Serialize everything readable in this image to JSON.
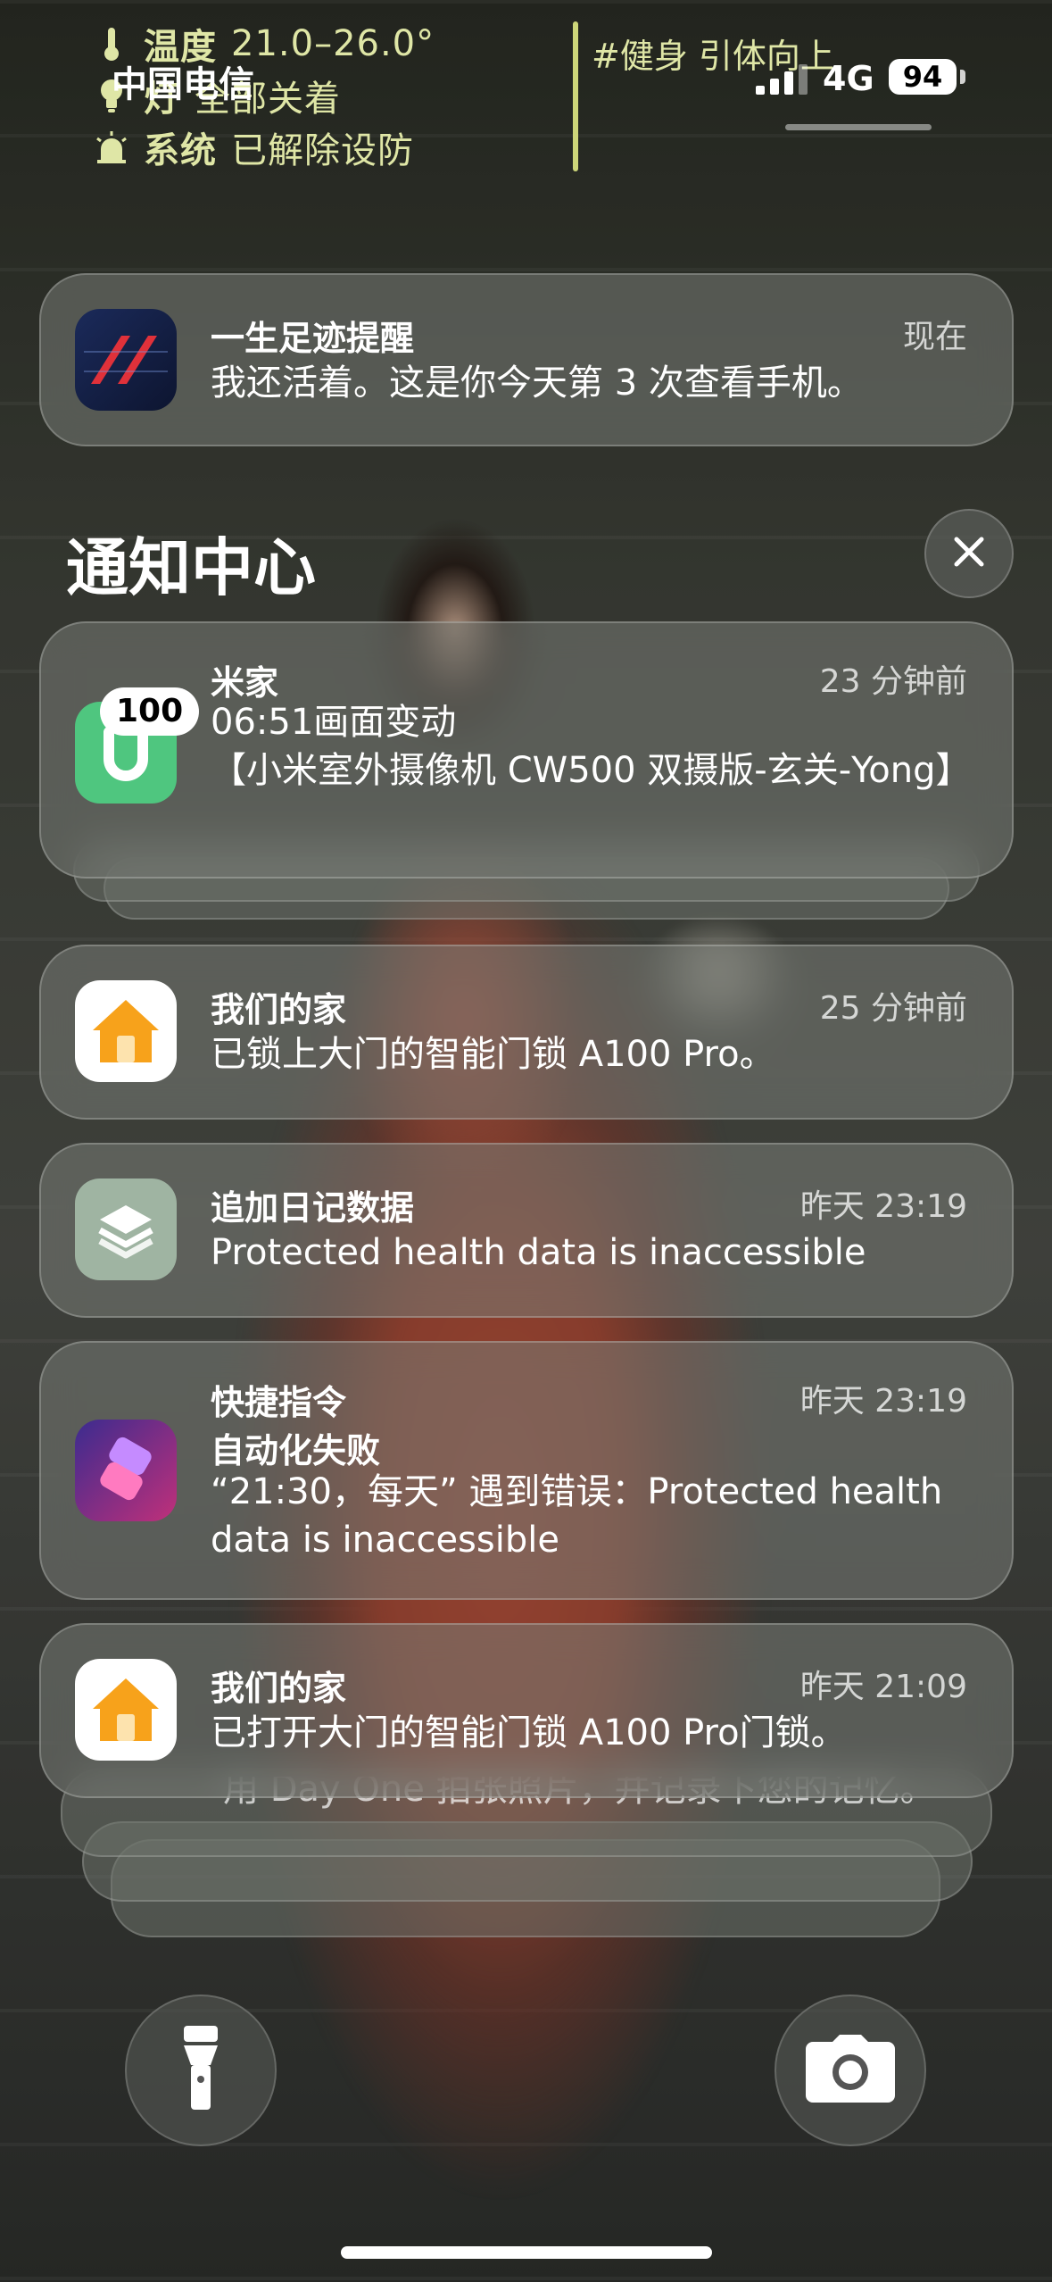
{
  "status_bar": {
    "carrier": "中国电信",
    "network": "4G",
    "battery": "94",
    "fitness_widget": "#健身 引体向上"
  },
  "widget": {
    "rows": [
      {
        "icon": "thermometer-icon",
        "key": "温度",
        "value": "21.0–26.0°"
      },
      {
        "icon": "lightbulb-icon",
        "key": "灯",
        "value": "全部关着"
      },
      {
        "icon": "alarm-icon",
        "key": "系统",
        "value": "已解除设防"
      }
    ]
  },
  "pinned": {
    "title": "一生足迹提醒",
    "time": "现在",
    "body": "我还活着。这是你今天第 3 次查看手机。"
  },
  "notification_center": {
    "title": "通知中心"
  },
  "notifications": [
    {
      "app": "米家",
      "time": "23 分钟前",
      "badge": "100",
      "body": "06:51画面变动\n【小米室外摄像机 CW500 双摄版-玄关-Yong】"
    },
    {
      "app": "我们的家",
      "time": "25 分钟前",
      "body": "已锁上大门的智能门锁 A100 Pro。"
    },
    {
      "app": "追加日记数据",
      "time": "昨天 23:19",
      "body": "Protected health data is inaccessible"
    },
    {
      "app": "快捷指令",
      "subtitle": "自动化失败",
      "time": "昨天 23:19",
      "body": "“21:30，每天” 遇到错误：Protected health data is inaccessible"
    },
    {
      "app": "我们的家",
      "time": "昨天 21:09",
      "body": "已打开大门的智能门锁 A100 Pro门锁。"
    }
  ],
  "peek": "用 Day One 拍张照片，并记录下您的记忆。"
}
